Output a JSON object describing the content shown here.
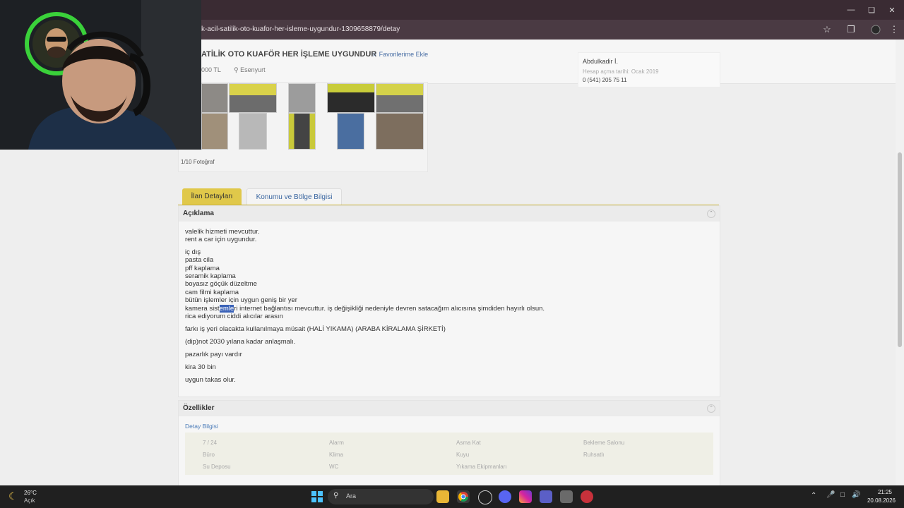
{
  "browser": {
    "url": "atilik-acil-satilik-oto-kuafor-her-isleme-uygundur-1309658879/detay"
  },
  "listing": {
    "title": "ATİLİK OTO KUAFÖR HER İŞLEME UYGUNDUR",
    "favorite_label": "Favorilerime Ekle",
    "price": "000 TL",
    "location": "Esenyurt"
  },
  "seller": {
    "name": "Abdulkadir İ.",
    "joined": "Hesap açma tarihi: Ocak 2019",
    "phone": "0 (541) 205 75 11"
  },
  "gallery": {
    "photo_count": "1/10 Fotoğraf"
  },
  "tabs": [
    {
      "label": "İlan Detayları"
    },
    {
      "label": "Konumu ve Bölge Bilgisi"
    }
  ],
  "description": {
    "title": "Açıklama",
    "lines": [
      "valelik hizmeti mevcuttur.",
      "rent a car için uygundur.",
      "iç dış",
      "pasta cila",
      "pff kaplama",
      "seramik kaplama",
      "boyasız göçük düzeltme",
      "cam filmi kaplama",
      "bütün işlemler için uygun geniş bir yer",
      "rica ediyorum ciddi alıcılar arasın",
      "farkı iş yeri olacakta kullanılmaya müsait (HALİ YIKAMA) (ARABA KİRALAMA ŞİRKETİ)",
      "(dip)not 2030 yılana kadar anlaşmalı.",
      "pazarlık payı vardır",
      "kira 30 bin",
      "uygun takas olur."
    ],
    "camera_line": {
      "before": "kamera sist",
      "highlight": "emle",
      "after": "ri internet bağlantısı mevcuttur. iş değişikliği nedeniyle devren satacağım alıcısına şimdiden hayırlı olsun."
    }
  },
  "features": {
    "title": "Özellikler",
    "detail_label": "Detay Bilgisi",
    "items": [
      "7 / 24",
      "Alarm",
      "Asma Kat",
      "Bekleme Salonu",
      "Büro",
      "Klima",
      "Kuyu",
      "Ruhsatlı",
      "Su Deposu",
      "WC",
      "Yıkama Ekipmanları"
    ]
  },
  "taskbar": {
    "weather_temp": "26°C",
    "weather_condition": "Açık",
    "search_placeholder": "Ara",
    "time": "21:25",
    "date": "20.08.2026"
  },
  "colors": {
    "accent_tab": "#e0c84a",
    "link": "#3a66a0",
    "titlebar": "#3a2b33"
  }
}
